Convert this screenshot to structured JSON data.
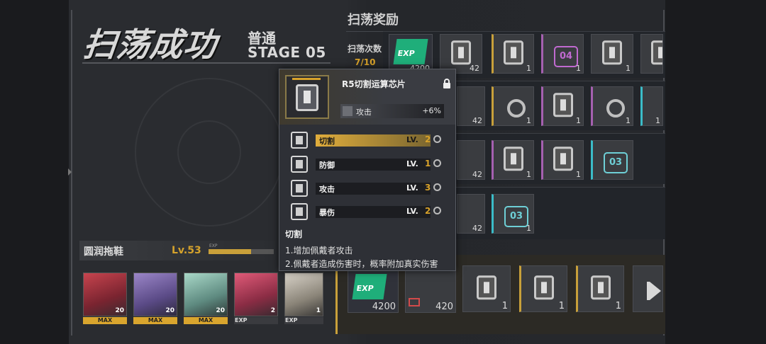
{
  "result": {
    "title": "扫荡成功",
    "mode": "普通",
    "stage": "STAGE 05"
  },
  "rewards": {
    "section_title": "扫荡奖励",
    "count_label": "扫荡次数",
    "count_value": "7/10",
    "row1": [
      {
        "type": "exp",
        "label": "EXP",
        "count": "4200"
      },
      {
        "type": "chip",
        "count": "42"
      },
      {
        "type": "chip",
        "count": "1"
      },
      {
        "type": "badge",
        "badge": "04",
        "count": "1"
      },
      {
        "type": "chip",
        "count": "1"
      },
      {
        "type": "chip",
        "count": ""
      }
    ],
    "row2_counts": [
      "42",
      "1",
      "1",
      "1",
      "1"
    ],
    "row3_counts": [
      "42",
      "1",
      "1"
    ],
    "row3_badge": "03",
    "row4_counts": [
      "42",
      "1"
    ],
    "row4_badge": "03",
    "bottom_row": [
      {
        "type": "exp",
        "label": "EXP",
        "count": "4200"
      },
      {
        "type": "mail",
        "count": "420"
      },
      {
        "type": "chip",
        "count": "1"
      },
      {
        "type": "chip",
        "count": "1"
      },
      {
        "type": "chip",
        "count": "1"
      }
    ]
  },
  "character": {
    "name": "圆润拖鞋",
    "level": "Lv.53",
    "exp_label": "EXP",
    "exp_fraction": 0.65
  },
  "team": [
    {
      "level": "20",
      "tag": "MAX",
      "tag_type": "max"
    },
    {
      "level": "20",
      "tag": "MAX",
      "tag_type": "max"
    },
    {
      "level": "20",
      "tag": "MAX",
      "tag_type": "max"
    },
    {
      "level": "2",
      "tag": "EXP",
      "tag_type": "exp"
    },
    {
      "level": "1",
      "tag": "EXP",
      "tag_type": "exp"
    }
  ],
  "popup": {
    "title": "R5切割运算芯片",
    "attribute": {
      "name": "攻击",
      "value": "+6%"
    },
    "skills": [
      {
        "name": "切割",
        "lv_label": "LV.",
        "lv": "2",
        "active": true
      },
      {
        "name": "防御",
        "lv_label": "LV.",
        "lv": "1",
        "active": false
      },
      {
        "name": "攻击",
        "lv_label": "LV.",
        "lv": "3",
        "active": false
      },
      {
        "name": "暴伤",
        "lv_label": "LV.",
        "lv": "2",
        "active": false
      }
    ],
    "desc_title": "切割",
    "desc_lines": [
      "1.增加佩戴者攻击",
      "2.佩戴者造成伤害时，概率附加真实伤害"
    ]
  },
  "colors": {
    "accent_gold": "#d8a22a",
    "teal": "#6ecfd6",
    "pink": "#c06ad0",
    "exp_green": "#1fae7a"
  }
}
